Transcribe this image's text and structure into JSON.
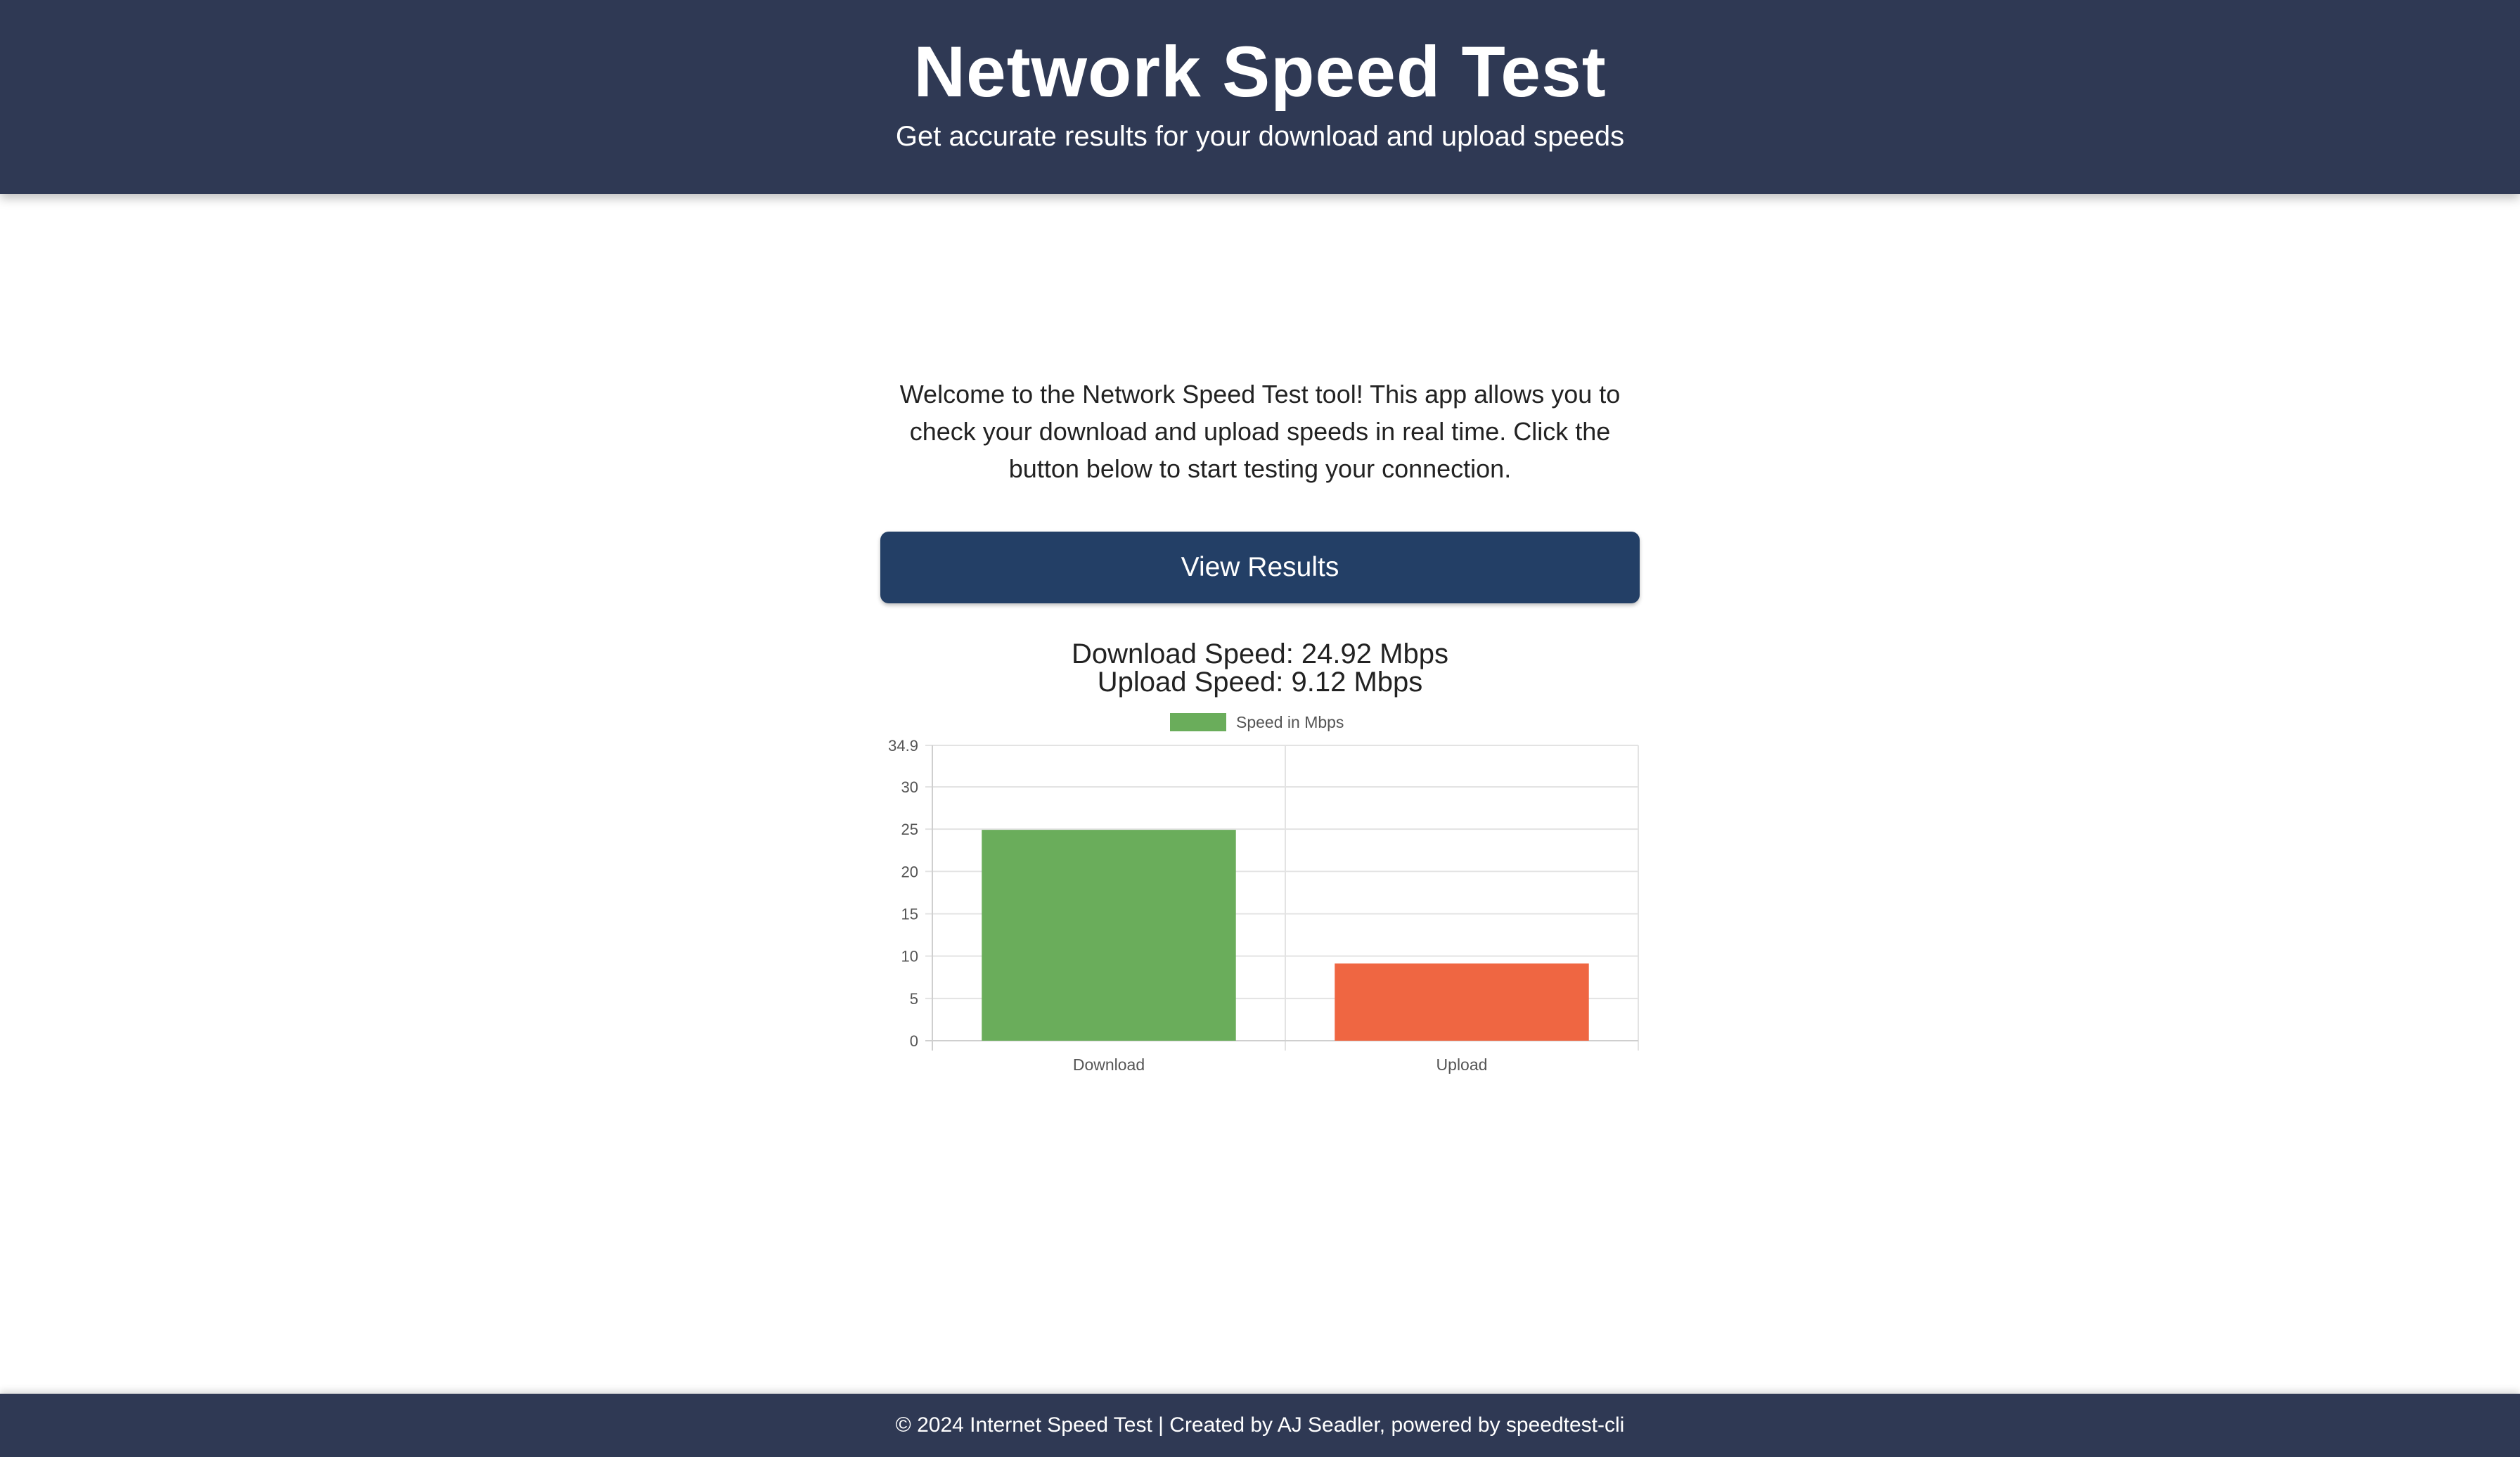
{
  "header": {
    "title": "Network Speed Test",
    "subtitle": "Get accurate results for your download and upload speeds"
  },
  "intro": {
    "text": "Welcome to the Network Speed Test tool! This app allows you to check your download and upload speeds in real time. Click the button below to start testing your connection."
  },
  "actions": {
    "view_results_label": "View Results"
  },
  "results": {
    "download_text": "Download Speed: 24.92 Mbps",
    "upload_text": "Upload Speed: 9.12 Mbps"
  },
  "chart_data": {
    "type": "bar",
    "categories": [
      "Download",
      "Upload"
    ],
    "series": [
      {
        "name": "Speed in Mbps",
        "values": [
          24.92,
          9.12
        ],
        "colors": [
          "#6aad5b",
          "#ef6642"
        ]
      }
    ],
    "legend_color": "#6aad5b",
    "legend_position": "top",
    "ylim": [
      0,
      34.9
    ],
    "yticks": [
      0,
      5,
      10,
      15,
      20,
      25,
      30,
      34.9
    ],
    "grid": true
  },
  "footer": {
    "text": "© 2024 Internet Speed Test | Created by AJ Seadler, powered by speedtest-cli"
  },
  "colors": {
    "header_bg": "#2f3954",
    "button_bg": "#233f66",
    "footer_bg": "#2f3954"
  }
}
